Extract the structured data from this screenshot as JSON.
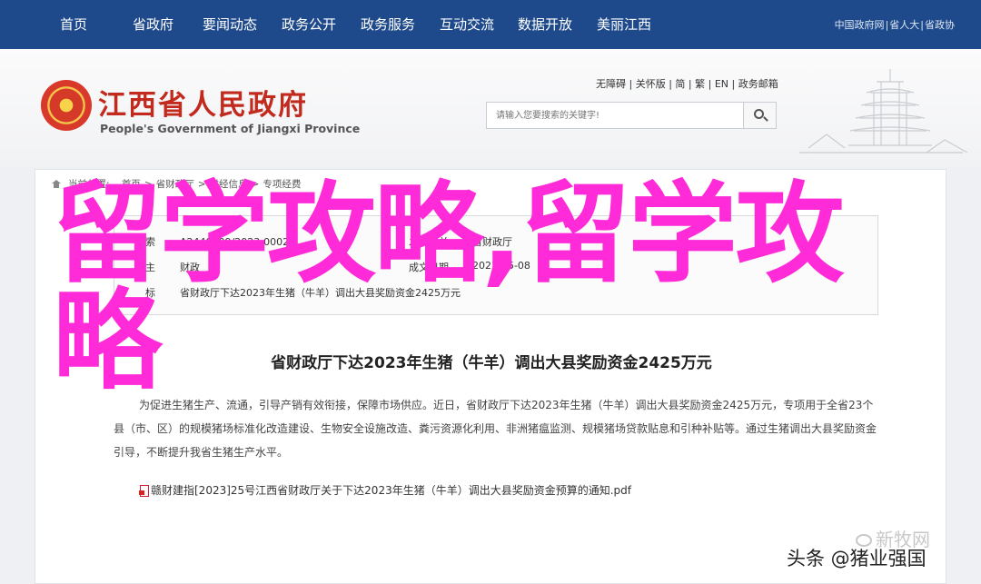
{
  "nav": {
    "items": [
      "首页",
      "省政府",
      "要闻动态",
      "政务公开",
      "政务服务",
      "互动交流",
      "数据开放",
      "美丽江西"
    ],
    "toplinks": [
      "中国政府网",
      "省人大",
      "省政协"
    ]
  },
  "header": {
    "title": "江西省人民政府",
    "subtitle": "People's Government of Jiangxi Province",
    "util_links": [
      "无障碍",
      "关怀版",
      "简",
      "繁",
      "EN",
      "政务邮箱"
    ],
    "search_placeholder": "请输入您要搜索的关键字!"
  },
  "breadcrumb": {
    "prefix": "当前位置:",
    "items": [
      "首页",
      "省财政厅",
      "财经信息",
      "专项经费"
    ]
  },
  "info": {
    "rows": [
      {
        "label": "索",
        "value": "A2440009/2023-00028",
        "label2": "发文机关",
        "value2": "省财政厅"
      },
      {
        "label": "主",
        "value": "财政",
        "label2": "成文日期",
        "value2": "2023-05-08"
      },
      {
        "label": "标",
        "value": "省财政厅下达2023年生猪（牛羊）调出大县奖励资金2425万元",
        "label2": "",
        "value2": ""
      }
    ]
  },
  "article": {
    "title": "省财政厅下达2023年生猪（牛羊）调出大县奖励资金2425万元",
    "body": "为促进生猪生产、流通，引导产销有效衔接，保障市场供应。近日，省财政厅下达2023年生猪（牛羊）调出大县奖励资金2425万元，专项用于全省23个县（市、区）的规模猪场标准化改造建设、生物安全设施改造、粪污资源化利用、非洲猪瘟监测、规模猪场贷款贴息和引种补贴等。通过生猪调出大县奖励资金引导，不断提升我省生猪生产水平。",
    "attachment": "赣财建指[2023]25号江西省财政厅关于下达2023年生猪（牛羊）调出大县奖励资金预算的通知.pdf"
  },
  "overlay": {
    "text": "留学攻略,留学攻略"
  },
  "watermark": {
    "line1": "新牧网",
    "line2": "头条 @猪业强国"
  },
  "colors": {
    "nav_bg": "#1e4a8c",
    "title_red": "#c22a1e",
    "overlay": "#ff2bd8"
  }
}
